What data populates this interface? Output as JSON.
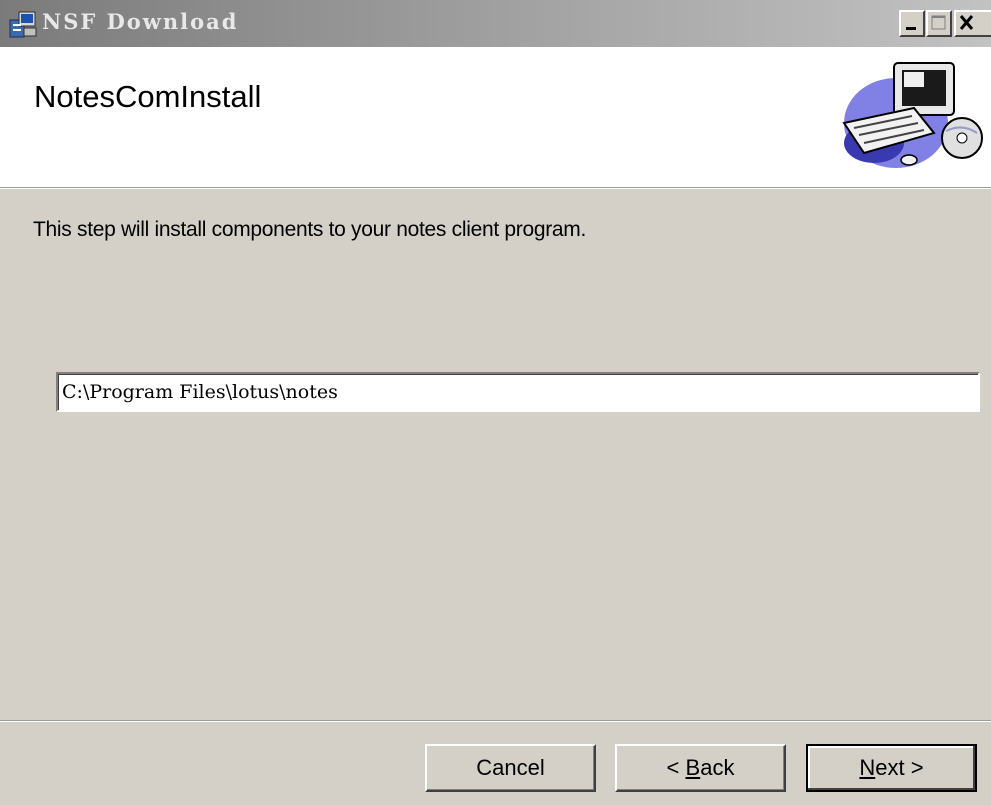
{
  "window": {
    "title": "NSF Download",
    "controls": {
      "minimize": "_",
      "maximize": "□",
      "close": "×"
    }
  },
  "header": {
    "title": "NotesComInstall",
    "illustration": "computer-illustration"
  },
  "body": {
    "description": "This step will install components to your notes client program.",
    "install_path": "C:\\Program Files\\lotus\\notes"
  },
  "buttons": {
    "cancel": "Cancel",
    "back_prefix": "< ",
    "back_accel": "B",
    "back_rest": "ack",
    "next_accel": "N",
    "next_rest": "ext >"
  }
}
